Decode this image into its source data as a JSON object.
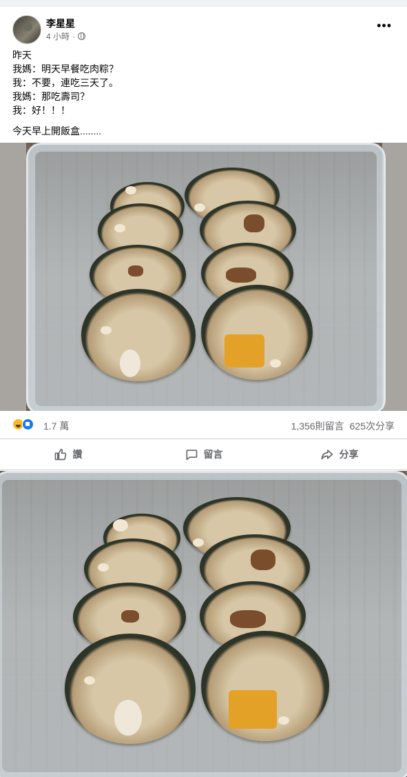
{
  "post": {
    "author": "李星星",
    "time": "4 小時",
    "lines": [
      "昨天",
      "我媽：明天早餐吃肉粽？",
      "我：不要，連吃三天了。",
      "我媽：那吃壽司？",
      "我：好！！！"
    ],
    "footer_line": "今天早上開飯盒........"
  },
  "reactions": {
    "count": "1.7 萬",
    "comments": "1,356則留言",
    "shares": "625次分享"
  },
  "actions": {
    "like": "讚",
    "comment": "留言",
    "share": "分享"
  },
  "colors": {
    "brand_blue": "#1877f2",
    "secondary_text": "#65676b",
    "haha_yellow": "#f7b928"
  },
  "icons": [
    "more-options-icon",
    "globe-icon",
    "haha-reaction-icon",
    "like-reaction-icon",
    "like-icon",
    "comment-icon",
    "share-icon"
  ]
}
